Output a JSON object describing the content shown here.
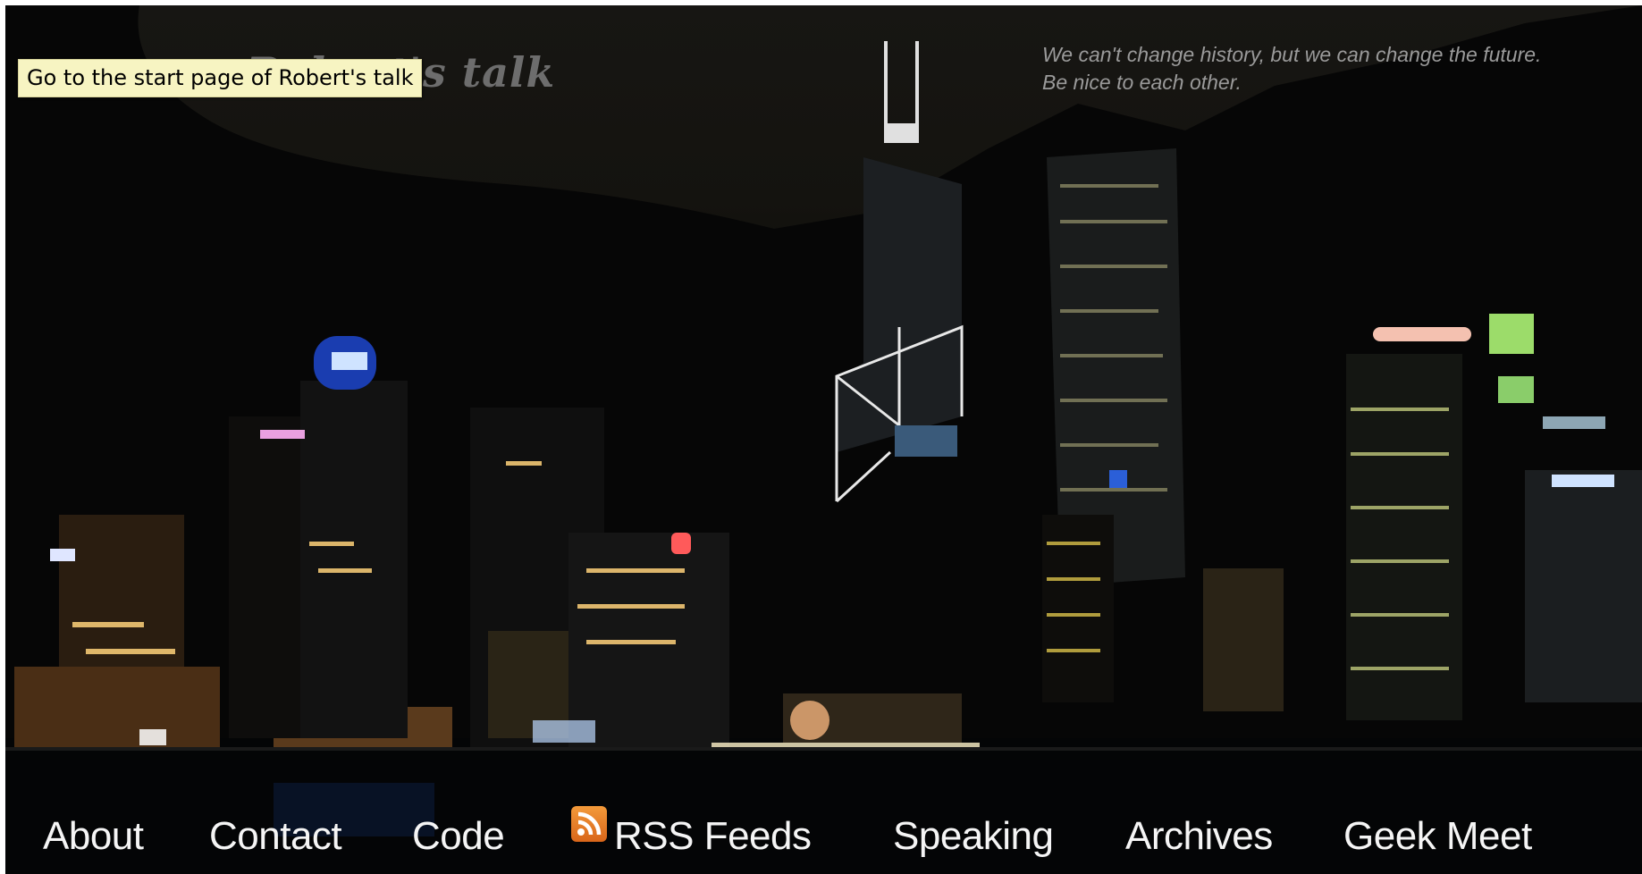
{
  "site": {
    "title": "Robert's talk",
    "tooltip": "Go to the start page of Robert's talk",
    "tagline_line1": "We can't change history, but we can change the future.",
    "tagline_line2": "Be nice to each other."
  },
  "nav": {
    "items": [
      {
        "label": "About",
        "icon": null
      },
      {
        "label": "Contact",
        "icon": null
      },
      {
        "label": "Code",
        "icon": null
      },
      {
        "label": "RSS Feeds",
        "icon": "rss-icon"
      },
      {
        "label": "Speaking",
        "icon": null
      },
      {
        "label": "Archives",
        "icon": null
      },
      {
        "label": "Geek Meet",
        "icon": null
      }
    ]
  },
  "colors": {
    "sky": "#171613",
    "ground": "#050505",
    "nav_text": "#f5f5f5",
    "tagline_text": "#9a9a9a",
    "tooltip_bg": "#f7f4c2",
    "rss_orange": "#e8802a"
  }
}
